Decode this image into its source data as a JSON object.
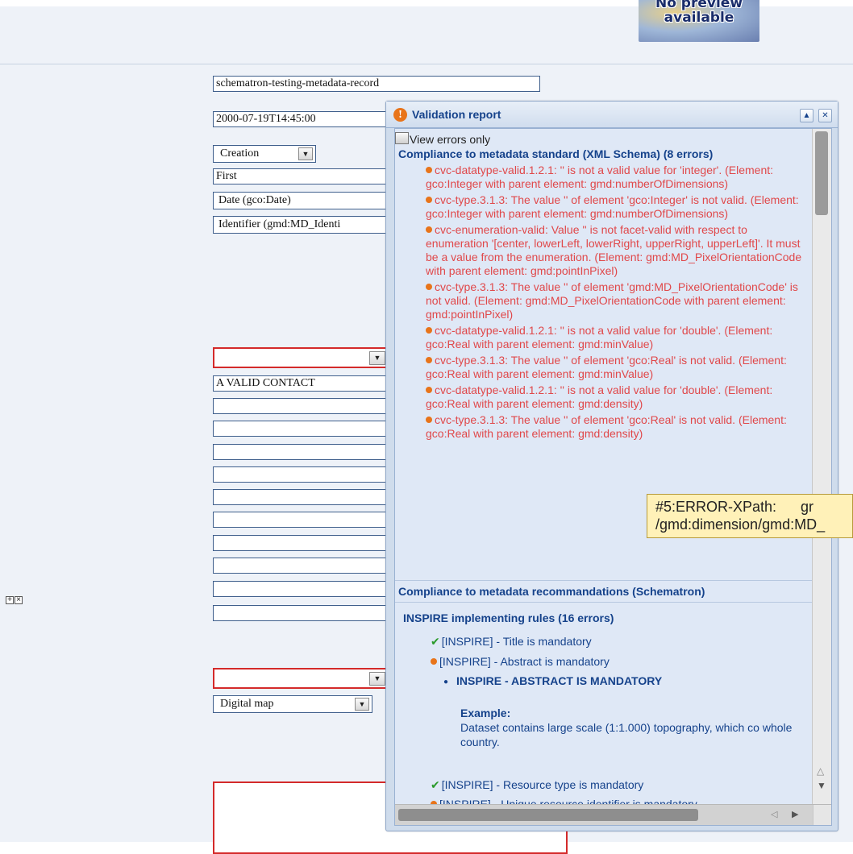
{
  "preview": {
    "line1": "No preview",
    "line2": "available"
  },
  "form": {
    "title_value": "schematron-testing-metadata-record",
    "date_value": "2000-07-19T14:45:00",
    "date_type": "Creation",
    "edition": "First",
    "date_type_label": "Date (gco:Date)",
    "identifier_label": "Identifier (gmd:MD_Identi",
    "contact_value": "A VALID CONTACT",
    "presentation_form": "Digital map"
  },
  "icons": {
    "expand": "plus-icon",
    "remove": "close-icon"
  },
  "validation": {
    "title": "Validation report",
    "view_errors_only": "View errors only",
    "xsd_heading": "Compliance to metadata standard (XML Schema) (8 errors)",
    "xsd_errors": [
      "cvc-datatype-valid.1.2.1: '' is not a valid value for 'integer'. (Element: gco:Integer with parent element: gmd:numberOfDimensions)",
      "cvc-type.3.1.3: The value '' of element 'gco:Integer' is not valid. (Element: gco:Integer with parent element: gmd:numberOfDimensions)",
      "cvc-enumeration-valid: Value '' is not facet-valid with respect to enumeration '[center, lowerLeft, lowerRight, upperRight, upperLeft]'. It must be a value from the enumeration. (Element: gmd:MD_PixelOrientationCode with parent element: gmd:pointInPixel)",
      "cvc-type.3.1.3: The value '' of element 'gmd:MD_PixelOrientationCode' is not valid. (Element: gmd:MD_PixelOrientationCode with parent element: gmd:pointInPixel)",
      "cvc-datatype-valid.1.2.1: '' is not a valid value for 'double'. (Element: gco:Real with parent element: gmd:minValue)",
      "cvc-type.3.1.3: The value '' of element 'gco:Real' is not valid. (Element: gco:Real with parent element: gmd:minValue)",
      "cvc-datatype-valid.1.2.1: '' is not a valid value for 'double'. (Element: gco:Real with parent element: gmd:density)",
      "cvc-type.3.1.3: The value '' of element 'gco:Real' is not valid. (Element: gco:Real with parent element: gmd:density)"
    ],
    "schematron_heading": "Compliance to metadata recommandations (Schematron)",
    "inspire_heading": "INSPIRE implementing rules (16 errors)",
    "rules": {
      "r1": "[INSPIRE] - Title is mandatory",
      "r2": "[INSPIRE] - Abstract is mandatory",
      "r3": "[INSPIRE] - Resource type is mandatory",
      "r4": "[INSPIRE] - Unique resource identifier is mandatory"
    },
    "abstract_bullet": "INSPIRE - ABSTRACT IS MANDATORY",
    "example_label": "Example:",
    "example_text": "Dataset contains large scale (1:1.000) topography, which co whole country."
  },
  "tooltip": {
    "line1_a": "#5:ERROR-XPath:",
    "line1_b": "gr",
    "line2": "/gmd:dimension/gmd:MD_"
  },
  "colors": {
    "page_bg": "#eef2f8",
    "header_text": "#15428b",
    "error_text": "#e0484a",
    "error_field_border": "#d42a2a",
    "tooltip_bg": "#fff1b8"
  }
}
